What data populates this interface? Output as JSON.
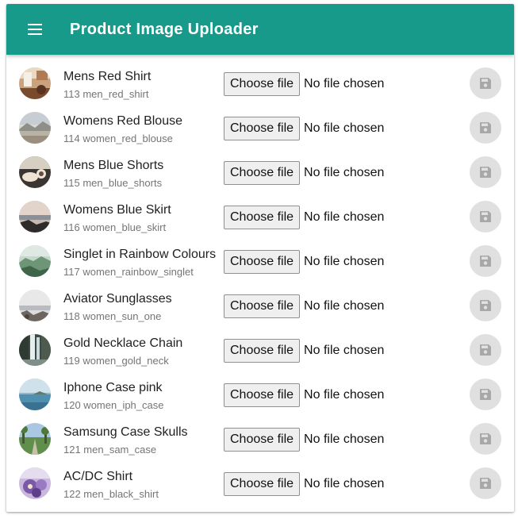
{
  "app": {
    "title": "Product Image Uploader",
    "accent_color": "#179a8a",
    "menu_icon": "hamburger-menu-icon"
  },
  "file_input": {
    "button_label": "Choose file",
    "status_text": "No file chosen"
  },
  "save_icon": "floppy-disk-save-icon",
  "products": [
    {
      "name": "Mens Red Shirt",
      "code": "113 men_red_shirt",
      "thumb": "indoor-room-photo"
    },
    {
      "name": "Womens Red Blouse",
      "code": "114 women_red_blouse",
      "thumb": "misty-landscape-photo"
    },
    {
      "name": "Mens Blue Shorts",
      "code": "115 men_blue_shorts",
      "thumb": "hands-coffee-photo"
    },
    {
      "name": "Womens Blue Skirt",
      "code": "116 women_blue_skirt",
      "thumb": "sunset-shore-photo"
    },
    {
      "name": "Singlet in Rainbow Colours",
      "code": "117 women_rainbow_singlet",
      "thumb": "green-hills-photo"
    },
    {
      "name": "Aviator Sunglasses",
      "code": "118 women_sun_one",
      "thumb": "rocky-beach-photo"
    },
    {
      "name": "Gold Necklace Chain",
      "code": "119 women_gold_neck",
      "thumb": "waterfall-photo"
    },
    {
      "name": "Iphone Case pink",
      "code": "120 women_iph_case",
      "thumb": "sea-coast-photo"
    },
    {
      "name": "Samsung Case Skulls",
      "code": "121 men_sam_case",
      "thumb": "tree-road-photo"
    },
    {
      "name": "AC/DC Shirt",
      "code": "122 men_black_shirt",
      "thumb": "purple-flowers-photo"
    }
  ]
}
